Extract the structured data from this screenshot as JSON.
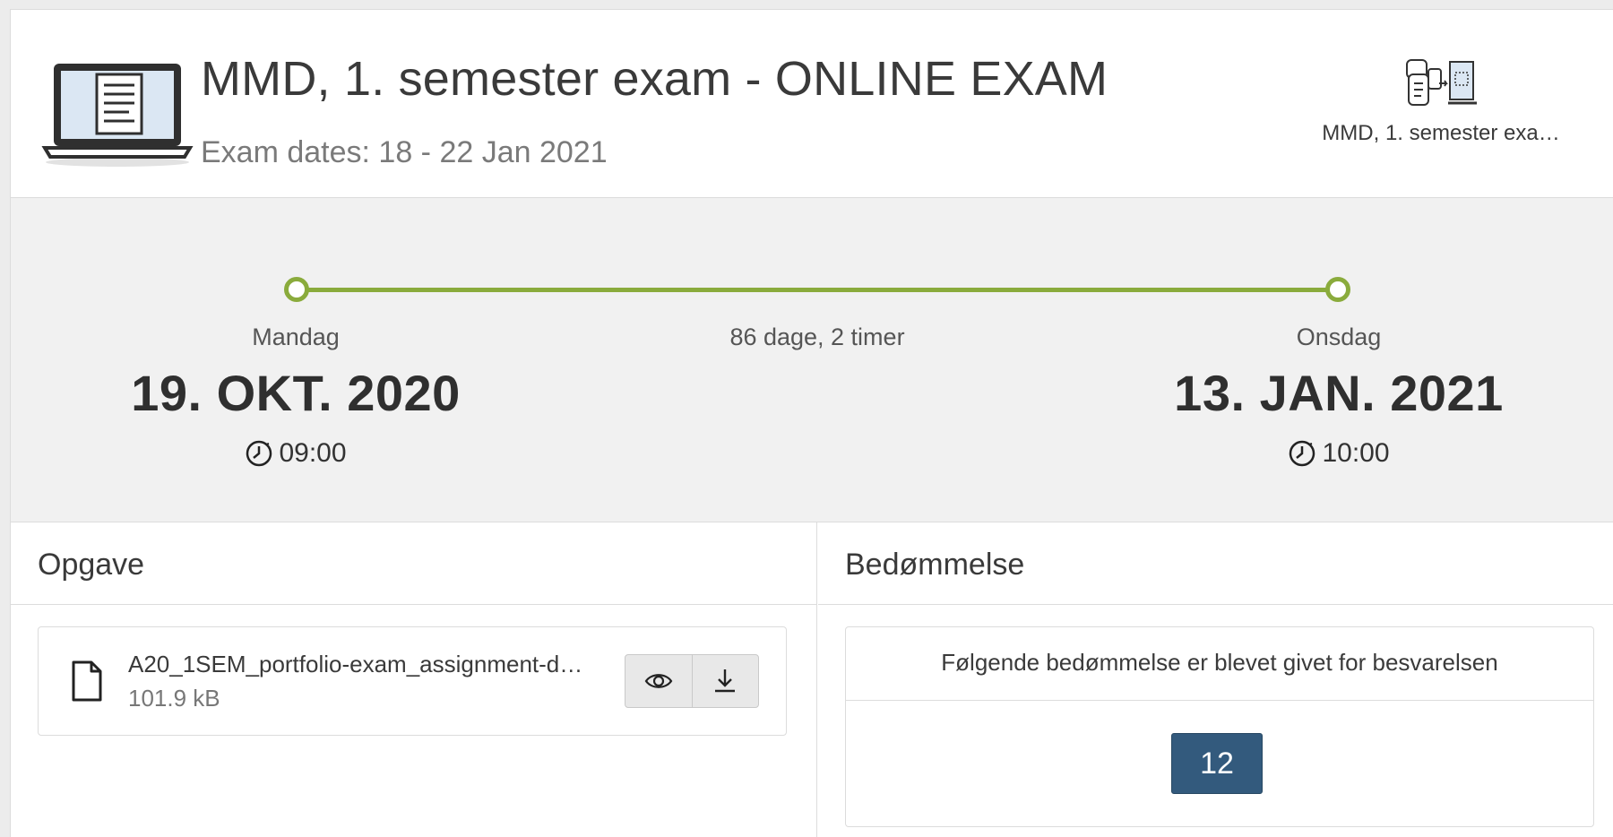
{
  "header": {
    "title": "MMD, 1. semester exam - ONLINE EXAM",
    "subtitle": "Exam dates: 18 - 22 Jan 2021",
    "course_name": "MMD, 1. semester exa…"
  },
  "timeline": {
    "start": {
      "day": "Mandag",
      "date": "19. OKT. 2020",
      "time": "09:00"
    },
    "end": {
      "day": "Onsdag",
      "date": "13. JAN. 2021",
      "time": "10:00"
    },
    "duration": "86 dage, 2 timer",
    "accent_color": "#8aab3c"
  },
  "assignment": {
    "heading": "Opgave",
    "file_name": "A20_1SEM_portfolio-exam_assignment-d…",
    "file_size": "101.9 kB",
    "actions": [
      "eye-icon",
      "download-icon"
    ]
  },
  "grading": {
    "heading": "Bedømmelse",
    "caption": "Følgende bedømmelse er blevet givet for besvarelsen",
    "grade": "12",
    "grade_color": "#335a7d"
  }
}
